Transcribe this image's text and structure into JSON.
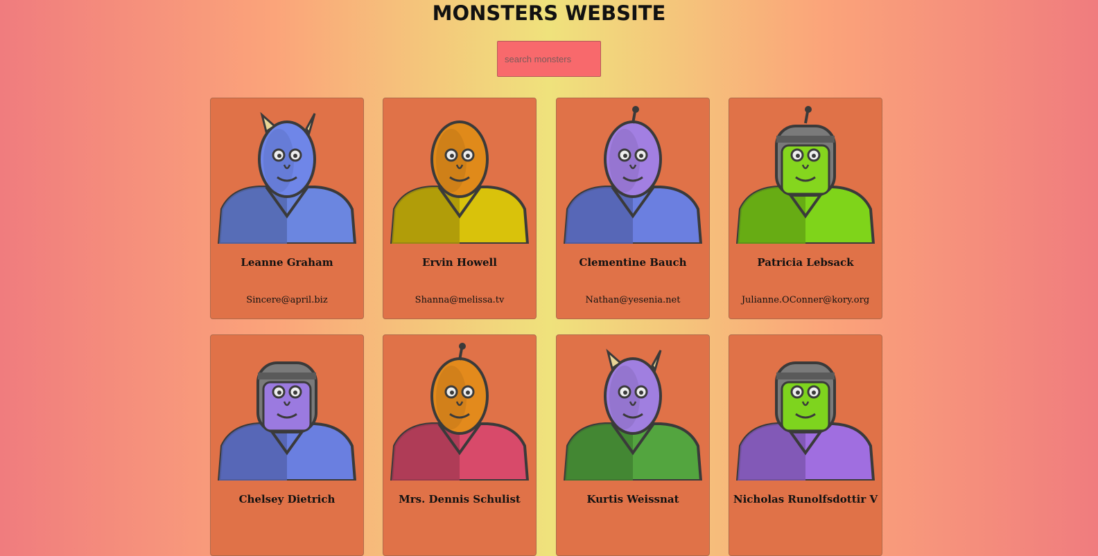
{
  "header": {
    "title": "MONSTERS WEBSITE"
  },
  "search": {
    "placeholder": "search monsters"
  },
  "monsters": [
    {
      "name": "Leanne Graham",
      "email": "Sincere@april.biz",
      "skin": "#6f86e8",
      "shirt": "#6b86e0",
      "horns": "#e8d596",
      "helmet": false,
      "antenna": false
    },
    {
      "name": "Ervin Howell",
      "email": "Shanna@melissa.tv",
      "skin": "#e08a1a",
      "shirt": "#d9c20b",
      "horns": "",
      "helmet": false,
      "antenna": false
    },
    {
      "name": "Clementine Bauch",
      "email": "Nathan@yesenia.net",
      "skin": "#a27fe2",
      "shirt": "#6b7fe0",
      "horns": "",
      "helmet": false,
      "antenna": true
    },
    {
      "name": "Patricia Lebsack",
      "email": "Julianne.OConner@kory.org",
      "skin": "#85d61e",
      "shirt": "#7fd41a",
      "horns": "",
      "helmet": true,
      "antenna": true
    },
    {
      "name": "Chelsey Dietrich",
      "email": "",
      "skin": "#9b7ae0",
      "shirt": "#6a7fe0",
      "horns": "",
      "helmet": true,
      "antenna": false
    },
    {
      "name": "Mrs. Dennis Schulist",
      "email": "",
      "skin": "#e38a1c",
      "shirt": "#d84a6a",
      "horns": "",
      "helmet": false,
      "antenna": true
    },
    {
      "name": "Kurtis Weissnat",
      "email": "",
      "skin": "#a07fe0",
      "shirt": "#53a53f",
      "horns": "#e8d596",
      "helmet": false,
      "antenna": false
    },
    {
      "name": "Nicholas Runolfsdottir V",
      "email": "",
      "skin": "#7ed41e",
      "shirt": "#a06ee0",
      "horns": "",
      "helmet": true,
      "antenna": false
    }
  ]
}
